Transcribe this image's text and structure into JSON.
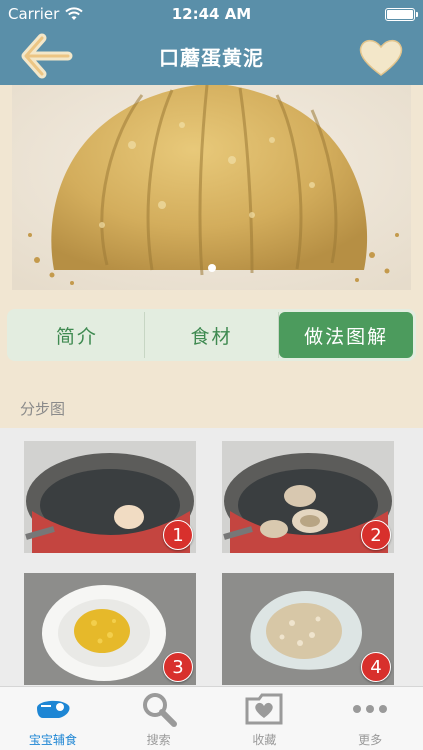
{
  "status_bar": {
    "carrier": "Carrier",
    "time": "12:44 AM"
  },
  "nav": {
    "title": "口蘑蛋黄泥",
    "back_icon": "back-arrow-icon",
    "favorite_icon": "heart-icon"
  },
  "segment": {
    "tabs": [
      {
        "label": "简介",
        "active": false
      },
      {
        "label": "食材",
        "active": false
      },
      {
        "label": "做法图解",
        "active": true
      }
    ]
  },
  "section_title": "分步图",
  "steps": [
    {
      "number": "1"
    },
    {
      "number": "2"
    },
    {
      "number": "3"
    },
    {
      "number": "4"
    }
  ],
  "tab_bar": {
    "items": [
      {
        "label": "宝宝辅食",
        "icon": "baby-bottle-icon",
        "active": true
      },
      {
        "label": "搜索",
        "icon": "search-icon",
        "active": false
      },
      {
        "label": "收藏",
        "icon": "favorites-folder-icon",
        "active": false
      },
      {
        "label": "更多",
        "icon": "more-dots-icon",
        "active": false
      }
    ]
  },
  "colors": {
    "nav": "#5a8fa9",
    "accent_green": "#4c9b5d",
    "badge_red": "#d8302c",
    "active_tab": "#1e86d4"
  }
}
